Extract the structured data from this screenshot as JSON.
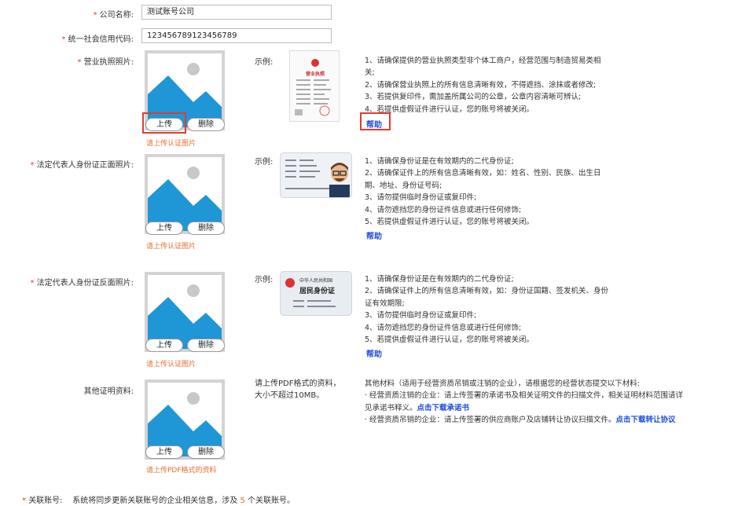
{
  "form": {
    "company_name": {
      "label": "公司名称:",
      "value": "测试账号公司"
    },
    "credit_code": {
      "label": "统一社会信用代码:",
      "value": "123456789123456789"
    }
  },
  "required_mark": "*",
  "upload_label": "上传",
  "delete_label": "删除",
  "example_label": "示例:",
  "help_label": "帮助",
  "sections": {
    "license": {
      "label": "营业执照照片:",
      "hint": "请上传认证图片",
      "example_title": "营业执照",
      "requirements": [
        "1、请确保提供的营业执照类型非个体工商户，经营范围与制造贸易类相",
        "关;",
        "2、请确保营业执照上的所有信息清晰有效，不得遮挡、涂抹或者修改;",
        "3、若提供复印件，需加盖所属公司的公章，公章内容清晰可辨认;",
        "4、若提供虚假证件进行认证，您的账号将被关闭。"
      ]
    },
    "id_front": {
      "label": "法定代表人身份证正面照片:",
      "hint": "请上传认证图片",
      "requirements": [
        "1、请确保身份证是在有效期内的二代身份证;",
        "2、请确保证件上的所有信息清晰有效，如：姓名、性别、民族、出生日",
        "期、地址、身份证号码;",
        "3、请勿提供临时身份证或复印件;",
        "4、请勿遮挡您的身份证件信息或进行任何修饰;",
        "5、若提供虚假证件进行认证，您的账号将被关闭。"
      ]
    },
    "id_back": {
      "label": "法定代表人身份证反面照片:",
      "hint": "请上传认证图片",
      "example_title1": "中华人民共和国",
      "example_title2": "居民身份证",
      "requirements": [
        "1、请确保身份证是在有效期内的二代身份证;",
        "2、请确保证件上的所有信息清晰有效，如：身份证国籍、签发机关、身份",
        "证有效期限;",
        "3、请勿提供临时身份证或复印件;",
        "4、请勿遮挡您的身份证件信息或进行任何修饰;",
        "5、若提供虚假证件进行认证，您的账号将被关闭。"
      ]
    },
    "other": {
      "label": "其他证明资料:",
      "hint": "请上传PDF格式的资料",
      "upload_note1": "请上传PDF格式的资料，",
      "upload_note2": "大小不超过10MB。",
      "intro": "其他材料（适用于经营资质吊销或注销的企业），请根据您的经营状态提交以下材料:",
      "item1_text": "· 经营资质注销的企业：请上传签署的承诺书及相关证明文件的扫描文件，相关证明材料范围请详",
      "item1_text2": "见承诺书释义。",
      "item1_link": "点击下载承诺书",
      "item2_text": "· 经营资质吊销的企业：请上传签署的供应商账户及店铺转让协议扫描文件。",
      "item2_link": "点击下载转让协议"
    }
  },
  "linked_accounts": {
    "label": "关联账号:",
    "text_before": "系统将同步更新关联账号的企业相关信息，涉及",
    "count": "5",
    "text_after": "个关联账号。"
  },
  "colors": {
    "required": "#e23c2a",
    "hint": "#ef6b2c",
    "link": "#1e4fd8",
    "placeholder_sky": "#1f96d6",
    "placeholder_border": "#d3d3d3"
  }
}
